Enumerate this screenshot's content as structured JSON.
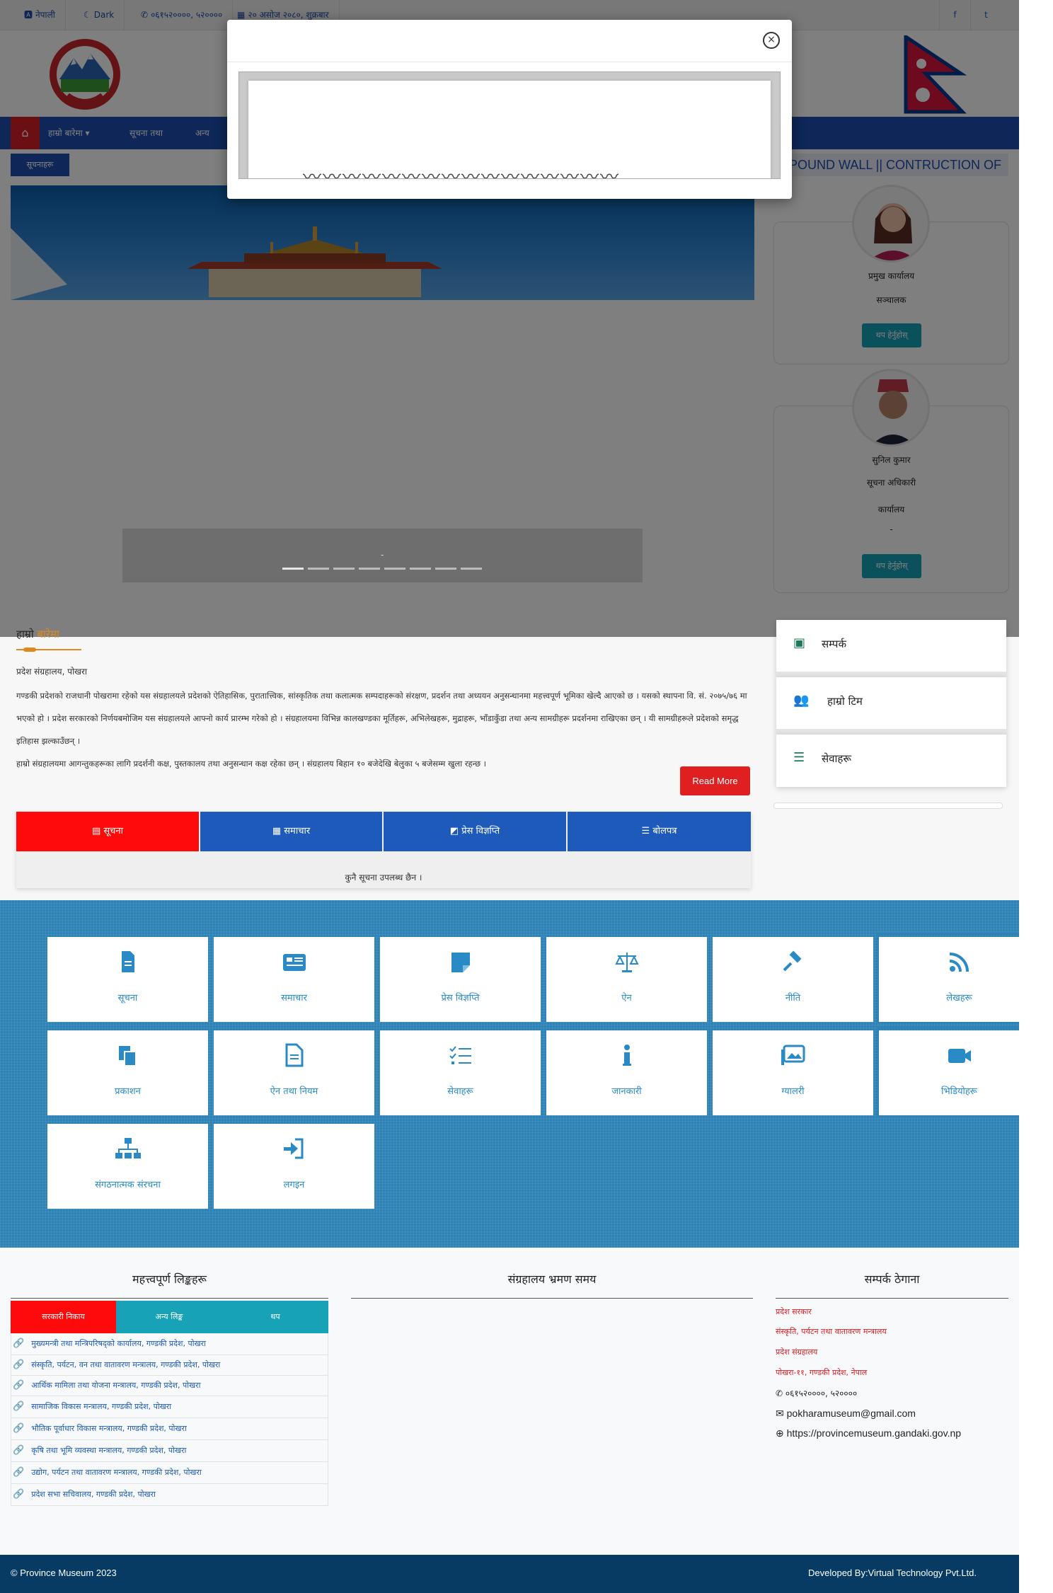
{
  "topbar": {
    "language": "नेपाली",
    "theme": "Dark",
    "phone": "०६१५२००००, ५२००००",
    "date": "२० असोज २०८०, शुक्रबार"
  },
  "nav": {
    "items": [
      "हाम्रो बारेमा",
      "सूचना तथा",
      "अन्य"
    ]
  },
  "notice": {
    "label": "सूचनाहरू",
    "marquee": "MPOUND WALL || CONTRUCTION OF"
  },
  "officials": [
    {
      "name": "प्रमुख कार्यालय",
      "role": "सञ्चालक",
      "button": "थप हेर्नुहोस्"
    },
    {
      "name": "सुनिल कुमार",
      "role": "सूचना अधिकारी",
      "office": "कार्यालय",
      "extra": "-",
      "button": "थप हेर्नुहोस्"
    }
  ],
  "about": {
    "title_a": "हाम्रो",
    "title_b": "बारेमा",
    "subtitle": "प्रदेश संग्रहालय, पोखरा",
    "para1": "गण्डकी प्रदेशको राजधानी पोखरामा रहेको यस संग्रहालयले प्रदेशको ऐतिहासिक, पुरातात्त्विक, सांस्कृतिक तथा कलात्मक सम्पदाहरूको संरक्षण, प्रदर्शन तथा अध्ययन अनुसन्धानमा महत्त्वपूर्ण भूमिका खेल्दै आएको छ । यसको स्थापना वि. सं. २०७५/७६ मा भएको हो । प्रदेश सरकारको निर्णयबमोजिम यस संग्रहालयले आफ्नो कार्य प्रारम्भ गरेको हो । संग्रहालयमा विभिन्न कालखण्डका मूर्तिहरू, अभिलेखहरू, मुद्राहरू, भाँडाकुँडा तथा अन्य सामग्रीहरू प्रदर्शनमा राखिएका छन् । यी सामग्रीहरूले प्रदेशको समृद्ध इतिहास झल्काउँछन् ।",
    "para2": "हाम्रो संग्रहालयमा आगन्तुकहरूका लागि प्रदर्शनी कक्ष, पुस्तकालय तथा अनुसन्धान कक्ष रहेका छन् । संग्रहालय बिहान १० बजेदेखि बेलुका ५ बजेसम्म खुला रहन्छ ।",
    "read_more": "Read More"
  },
  "tabs": {
    "items": [
      "सूचना",
      "समाचार",
      "प्रेस विज्ञप्ति",
      "बोलपत्र"
    ],
    "empty_text": "कुनै सूचना उपलब्ध छैन ।"
  },
  "side_cards": [
    "सम्पर्क",
    "हाम्रो टिम",
    "सेवाहरू"
  ],
  "grid": [
    {
      "label": "सूचना",
      "icon": "file-icon"
    },
    {
      "label": "समाचार",
      "icon": "newspaper-icon"
    },
    {
      "label": "प्रेस विज्ञप्ति",
      "icon": "note-icon"
    },
    {
      "label": "ऐन",
      "icon": "scale-icon"
    },
    {
      "label": "नीति",
      "icon": "gavel-icon"
    },
    {
      "label": "लेखहरू",
      "icon": "rss-icon"
    },
    {
      "label": "प्रकाशन",
      "icon": "copy-icon"
    },
    {
      "label": "ऐन तथा नियम",
      "icon": "document-icon"
    },
    {
      "label": "सेवाहरू",
      "icon": "list-check-icon"
    },
    {
      "label": "जानकारी",
      "icon": "info-icon"
    },
    {
      "label": "ग्यालरी",
      "icon": "image-icon"
    },
    {
      "label": "भिडियोहरू",
      "icon": "video-icon"
    },
    {
      "label": "संगठनात्मक संरचना",
      "icon": "sitemap-icon"
    },
    {
      "label": "लगइन",
      "icon": "login-icon"
    }
  ],
  "bottom": {
    "col1_title": "महत्त्वपूर्ण लिङ्कहरू",
    "col2_title": "संग्रहालय भ्रमण समय",
    "col3_title": "सम्पर्क ठेगाना",
    "link_tabs": [
      "सरकारी निकाय",
      "अन्य लिङ्क",
      "थप"
    ],
    "links": [
      "मुख्यमन्त्री तथा मन्त्रिपरिषद्को कार्यालय, गण्डकी प्रदेश, पोखरा",
      "संस्कृति, पर्यटन, वन तथा वातावरण मन्त्रालय, गण्डकी प्रदेश, पोखरा",
      "आर्थिक मामिला तथा योजना मन्त्रालय, गण्डकी प्रदेश, पोखरा",
      "सामाजिक विकास मन्त्रालय, गण्डकी प्रदेश, पोखरा",
      "भौतिक पूर्वाधार विकास मन्त्रालय, गण्डकी प्रदेश, पोखरा",
      "कृषि तथा भूमि व्यवस्था मन्त्रालय, गण्डकी प्रदेश, पोखरा",
      "उद्योग, पर्यटन तथा वातावरण मन्त्रालय, गण्डकी प्रदेश, पोखरा",
      "प्रदेश सभा सचिवालय, गण्डकी प्रदेश, पोखरा"
    ],
    "contact": {
      "line1": "प्रदेश सरकार",
      "line2": "संस्कृति, पर्यटन तथा वातावरण मन्त्रालय",
      "line3": "प्रदेश संग्रहालय",
      "line4": "पोखरा-११, गण्डकी प्रदेश, नेपाल",
      "phone": "०६१५२००००, ५२००००",
      "email": "pokharamuseum@gmail.com",
      "web": "https://provincemuseum.gandaki.gov.np"
    }
  },
  "footer": {
    "left": "© Province Museum 2023",
    "right": "Developed By:Virtual Technology Pvt.Ltd."
  }
}
